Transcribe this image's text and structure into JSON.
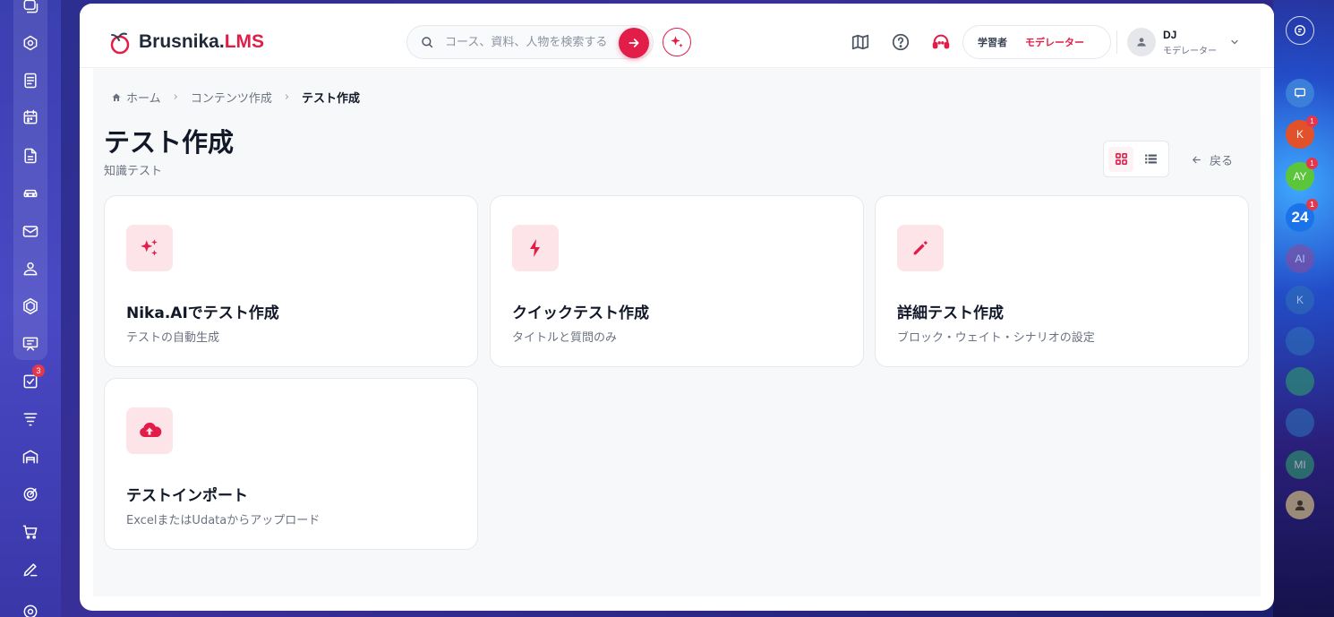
{
  "left_dock": {
    "items": [
      {
        "name": "chat-icon",
        "badge": ""
      },
      {
        "name": "settings-spark-icon",
        "badge": ""
      },
      {
        "name": "document-list-icon",
        "badge": ""
      },
      {
        "name": "calendar-icon",
        "badge": ""
      },
      {
        "name": "file-icon",
        "badge": ""
      },
      {
        "name": "car-icon",
        "badge": ""
      },
      {
        "name": "mail-icon",
        "badge": ""
      },
      {
        "name": "users-icon",
        "badge": ""
      },
      {
        "name": "hexagon-icon",
        "badge": ""
      },
      {
        "name": "presentation-icon",
        "badge": ""
      },
      {
        "name": "checklist-icon",
        "badge": "3"
      },
      {
        "name": "filter-icon",
        "badge": ""
      },
      {
        "name": "warehouse-icon",
        "badge": ""
      },
      {
        "name": "target-icon",
        "badge": ""
      },
      {
        "name": "cart-icon",
        "badge": ""
      },
      {
        "name": "pen-icon",
        "badge": ""
      },
      {
        "name": "gear-icon",
        "badge": ""
      }
    ]
  },
  "right_dock": {
    "items": [
      {
        "label": "K",
        "badge": "1",
        "color": "#e2512a"
      },
      {
        "label": "AY",
        "badge": "1",
        "color": "#5cc63a"
      },
      {
        "label": "24",
        "badge": "1",
        "color": "#1a73e8"
      },
      {
        "label": "AI",
        "badge": "",
        "color": "#8a4a9c"
      },
      {
        "label": "K",
        "badge": "",
        "color": "#2e6fb5"
      },
      {
        "label": "MI",
        "badge": "",
        "color": "#2f9e6a"
      }
    ]
  },
  "header": {
    "logo_name": "Brusnika.",
    "logo_accent": "LMS",
    "search_placeholder": "コース、資料、人物を検索する",
    "role_learner": "学習者",
    "role_moderator": "モデレーター",
    "user_initials": "DJ",
    "user_role": "モデレーター",
    "accent_color": "#e11d48"
  },
  "breadcrumb": {
    "home": "ホーム",
    "parent": "コンテンツ作成",
    "current": "テスト作成"
  },
  "page": {
    "title": "テスト作成",
    "subtitle": "知識テスト",
    "back_label": "戻る"
  },
  "cards": [
    {
      "title": "Nika.AIでテスト作成",
      "desc": "テストの自動生成",
      "icon": "sparkles-icon"
    },
    {
      "title": "クイックテスト作成",
      "desc": "タイトルと質問のみ",
      "icon": "lightning-icon"
    },
    {
      "title": "詳細テスト作成",
      "desc": "ブロック・ウェイト・シナリオの設定",
      "icon": "pencil-icon"
    },
    {
      "title": "テストインポート",
      "desc": "ExcelまたはUdataからアップロード",
      "icon": "cloud-upload-icon"
    }
  ]
}
